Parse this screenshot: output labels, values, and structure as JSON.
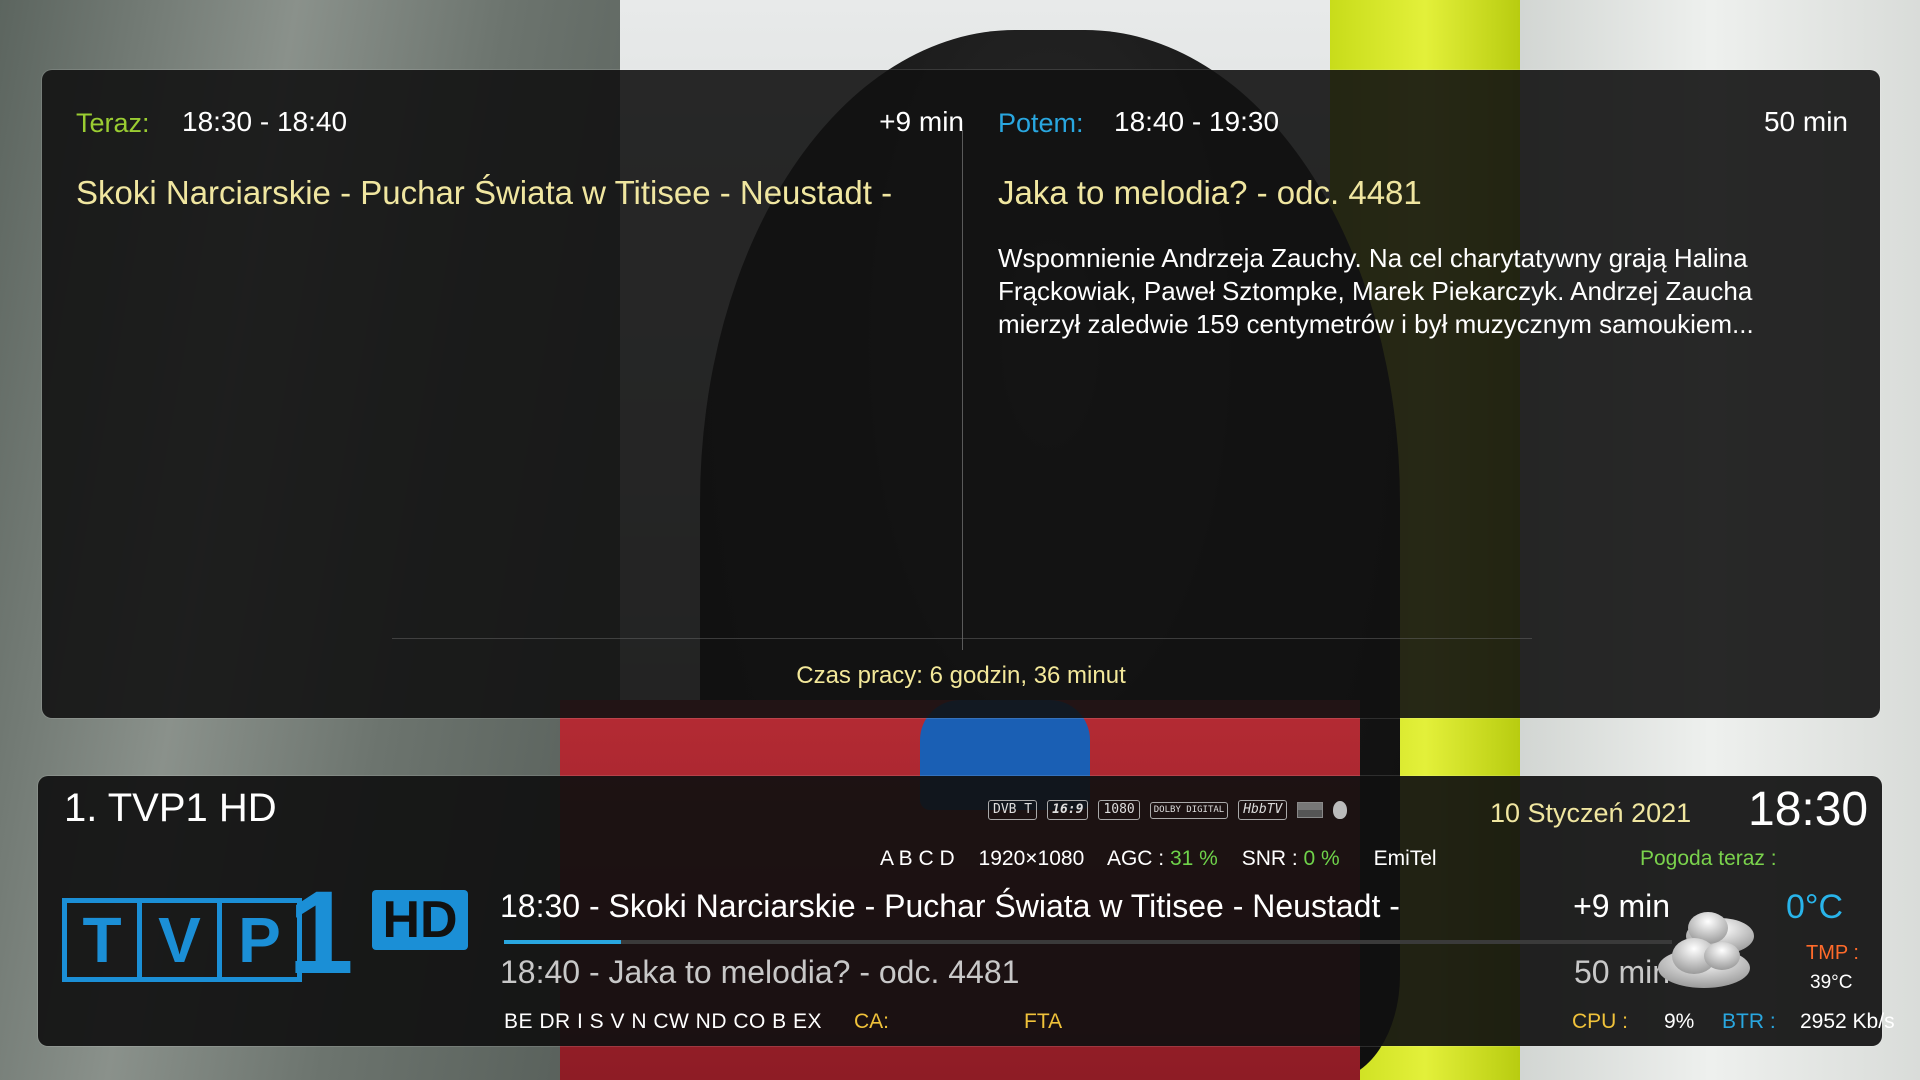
{
  "epg": {
    "now": {
      "label": "Teraz:",
      "time": "18:30 - 18:40",
      "duration": "+9 min",
      "title": "Skoki Narciarskie - Puchar Świata w Titisee - Neustadt -"
    },
    "next": {
      "label": "Potem:",
      "time": "18:40 - 19:30",
      "duration": "50 min",
      "title": "Jaka to melodia? - odc. 4481",
      "description": " Wspomnienie Andrzeja Zauchy. Na cel charytatywny grają Halina Frąckowiak, Paweł Sztompke, Marek Piekarczyk. Andrzej Zaucha mierzył zaledwie 159 centymetrów i był muzycznym samoukiem..."
    },
    "uptime": "Czas pracy: 6 godzin, 36 minut"
  },
  "infobar": {
    "channel": "1. TVP1 HD",
    "icons": [
      "DVB T",
      "16:9",
      "1080",
      "DOLBY DIGITAL",
      "HbbTV"
    ],
    "date": "10 Styczeń 2021",
    "clock": "18:30",
    "tech": {
      "cas": "A B C D",
      "resolution": "1920×1080",
      "agc_label": "AGC :",
      "agc_value": "31 %",
      "snr_label": "SNR :",
      "snr_value": "0 %",
      "provider": "EmiTel"
    },
    "weather_label": "Pogoda teraz :",
    "logo": {
      "letters": [
        "T",
        "V",
        "P"
      ],
      "number": "1",
      "hd": "HD"
    },
    "now": {
      "title": "18:30 - Skoki Narciarskie - Puchar Świata w Titisee - Neustadt -",
      "duration": "+9 min",
      "progress": 0.1
    },
    "next": {
      "title": "18:40 - Jaka to melodia? - odc. 4481",
      "duration": "50 min"
    },
    "weather": {
      "temp": "0°C",
      "tmp_label": "TMP :",
      "tmp_value": "39°C"
    },
    "bottom": {
      "caids": "BE DR I S V N CW ND CO B EX",
      "ca_label": "CA:",
      "ca_value": "FTA",
      "cpu_label": "CPU :",
      "cpu_value": "9%",
      "btr_label": "BTR :",
      "btr_value": "2952 Kb/s"
    }
  },
  "colors": {
    "accent_blue": "#29a7e0",
    "now_label": "#9acd32",
    "next_label": "#29a7e0",
    "title_yellow": "#f0e6a0"
  }
}
